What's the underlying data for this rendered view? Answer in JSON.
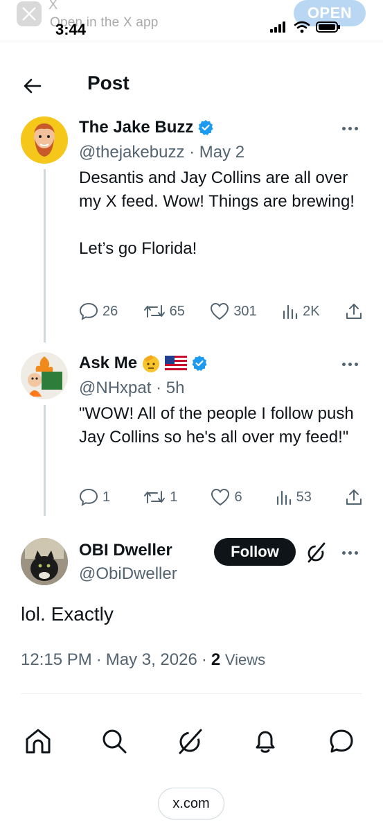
{
  "banner": {
    "app_letter": "X",
    "subtitle": "Open in the X app",
    "open_label": "OPEN"
  },
  "status_bar": {
    "time": "3:44"
  },
  "header": {
    "title": "Post"
  },
  "thread": [
    {
      "display_name": "The Jake Buzz",
      "handle": "@thejakebuzz",
      "date": "May 2",
      "text": "Desantis and Jay Collins are all over my X feed. Wow!  Things are brewing!\n\nLet’s go Florida!",
      "replies": "26",
      "reposts": "65",
      "likes": "301",
      "views": "2K"
    },
    {
      "display_name": "Ask Me",
      "handle": "@NHxpat",
      "date": "5h",
      "text": "\"WOW!  All of the people I follow push Jay Collins so he's all over my feed!\"",
      "replies": "1",
      "reposts": "1",
      "likes": "6",
      "views": "53"
    }
  ],
  "focused": {
    "display_name": "OBI Dweller",
    "handle": "@ObiDweller",
    "follow_label": "Follow",
    "text": "lol. Exactly",
    "time": "12:15 PM",
    "date": "May 3, 2026",
    "views_count": "2",
    "views_label": "Views"
  },
  "nav": {
    "items": [
      "home-icon",
      "search-icon",
      "grok-icon",
      "bell-icon",
      "messages-icon"
    ]
  },
  "url": "x.com",
  "colors": {
    "verified": "#1d9bf0",
    "text": "#0f1419",
    "muted": "#536471",
    "follow_bg": "#0f1419"
  }
}
